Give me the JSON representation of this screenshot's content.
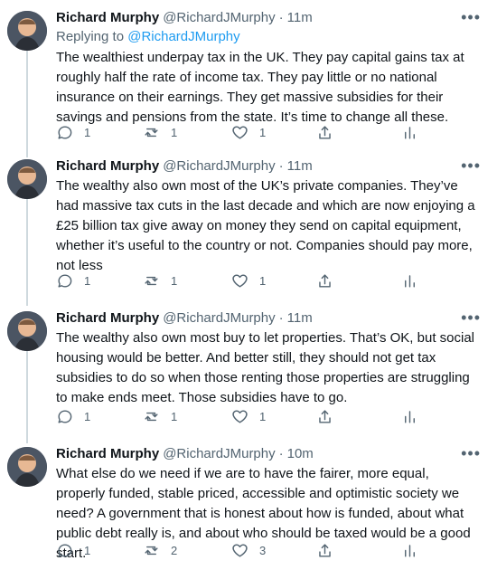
{
  "tweets": [
    {
      "name": "Richard Murphy",
      "handle": "@RichardJMurphy",
      "separator": "·",
      "time": "11m",
      "reply_prefix": "Replying to",
      "reply_to": "@RichardJMurphy",
      "text": "The wealthiest underpay tax in the UK. They pay capital gains tax at roughly half the rate of income tax. They pay little or no national insurance on their earnings. They get massive subsidies for their savings and pensions from the state. It’s time to change all these.",
      "replies": "1",
      "retweets": "1",
      "likes": "1"
    },
    {
      "name": "Richard Murphy",
      "handle": "@RichardJMurphy",
      "separator": "·",
      "time": "11m",
      "text": "The wealthy also own most of the UK’s private companies. They’ve had massive tax cuts in the last decade and which are now enjoying a £25 billion tax give away on money they send on capital equipment, whether it’s useful to the country or not. Companies should pay more, not less",
      "replies": "1",
      "retweets": "1",
      "likes": "1"
    },
    {
      "name": "Richard Murphy",
      "handle": "@RichardJMurphy",
      "separator": "·",
      "time": "11m",
      "text": "The wealthy also own most buy to let properties. That’s OK, but social housing would be better. And better still, they should not get tax subsidies to do so when those renting those properties are struggling to make ends meet. Those subsidies have to go.",
      "replies": "1",
      "retweets": "1",
      "likes": "1"
    },
    {
      "name": "Richard Murphy",
      "handle": "@RichardJMurphy",
      "separator": "·",
      "time": "10m",
      "text": "What else do we need if we are to have the fairer, more equal, properly funded, stable priced, accessible and optimistic society we need? A government that is honest about how is funded, about what public debt really is, and about who should be taxed would be a good start.",
      "replies": "1",
      "retweets": "2",
      "likes": "3"
    }
  ],
  "icons": {
    "more": "more-icon",
    "reply": "reply-icon",
    "retweet": "retweet-icon",
    "like": "heart-icon",
    "share": "share-icon",
    "analytics": "analytics-icon"
  }
}
